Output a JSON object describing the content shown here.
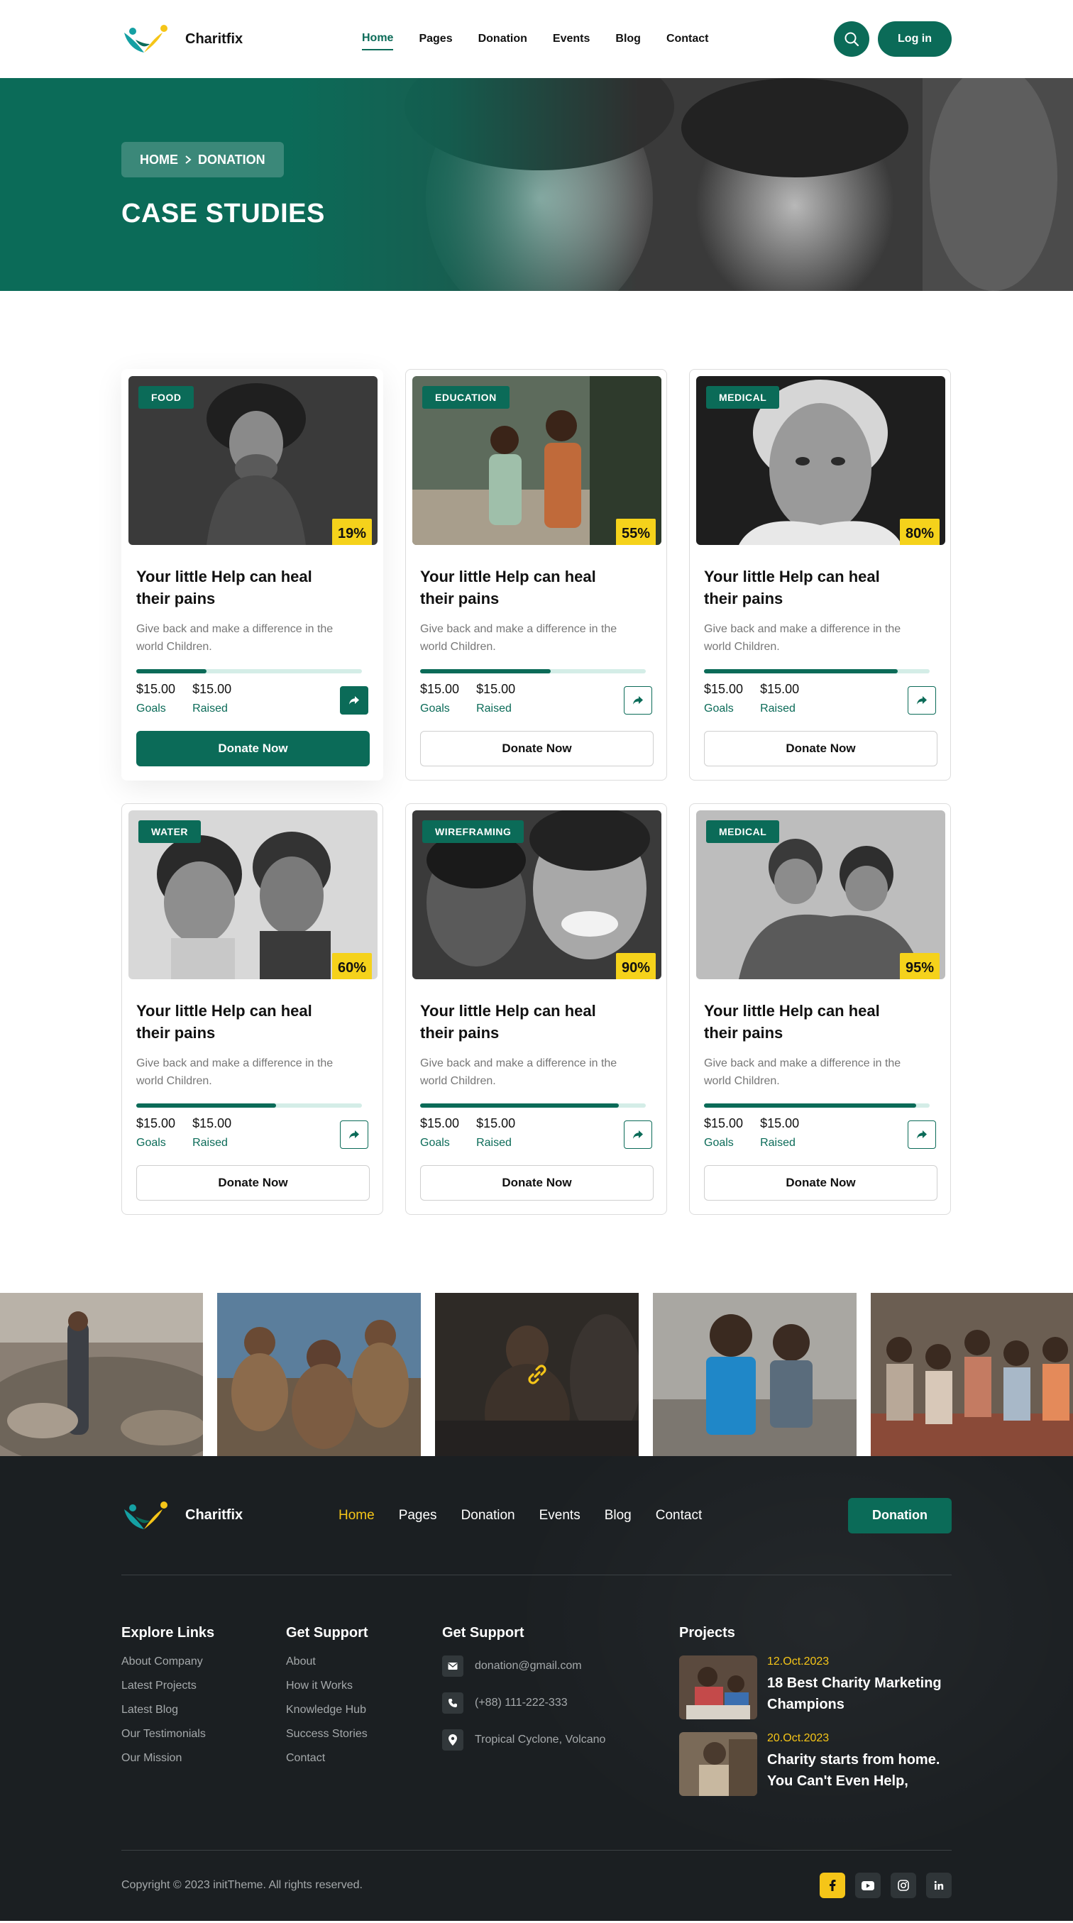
{
  "brand": {
    "name": "Charitfix"
  },
  "nav": {
    "items": [
      {
        "label": "Home",
        "active": true
      },
      {
        "label": "Pages"
      },
      {
        "label": "Donation"
      },
      {
        "label": "Events"
      },
      {
        "label": "Blog"
      },
      {
        "label": "Contact"
      }
    ],
    "login_label": "Log in",
    "search_icon": "search-icon"
  },
  "hero": {
    "breadcrumb": [
      "HOME",
      "DONATION"
    ],
    "title": "CASE STUDIES"
  },
  "colors": {
    "primary": "#0b6b58",
    "accent": "#f5d21b",
    "footer_bg": "#1b1f22",
    "link_yellow": "#f5c518"
  },
  "cards": [
    {
      "tag": "FOOD",
      "percent": "19%",
      "progress": 0.31,
      "title": "Your little Help can heal their pains",
      "desc": "Give back and make a difference in the world Children.",
      "goal": "$15.00",
      "goal_label": "Goals",
      "raised": "$15.00",
      "raised_label": "Raised",
      "button": "Donate Now",
      "featured": true
    },
    {
      "tag": "EDUCATION",
      "percent": "55%",
      "progress": 0.58,
      "title": "Your little Help can heal their pains",
      "desc": "Give back and make a difference in the world Children.",
      "goal": "$15.00",
      "goal_label": "Goals",
      "raised": "$15.00",
      "raised_label": "Raised",
      "button": "Donate Now",
      "featured": false
    },
    {
      "tag": "MEDICAL",
      "percent": "80%",
      "progress": 0.86,
      "title": "Your little Help can heal their pains",
      "desc": "Give back and make a difference in the world Children.",
      "goal": "$15.00",
      "goal_label": "Goals",
      "raised": "$15.00",
      "raised_label": "Raised",
      "button": "Donate Now",
      "featured": false
    },
    {
      "tag": "WATER",
      "percent": "60%",
      "progress": 0.62,
      "title": "Your little Help can heal their pains",
      "desc": "Give back and make a difference in the world Children.",
      "goal": "$15.00",
      "goal_label": "Goals",
      "raised": "$15.00",
      "raised_label": "Raised",
      "button": "Donate Now",
      "featured": false
    },
    {
      "tag": "WIREFRAMING",
      "percent": "90%",
      "progress": 0.88,
      "title": "Your little Help can heal their pains",
      "desc": "Give back and make a difference in the world Children.",
      "goal": "$15.00",
      "goal_label": "Goals",
      "raised": "$15.00",
      "raised_label": "Raised",
      "button": "Donate Now",
      "featured": false
    },
    {
      "tag": "MEDICAL",
      "percent": "95%",
      "progress": 0.94,
      "title": "Your little Help can heal their pains",
      "desc": "Give back and make a difference in the world Children.",
      "goal": "$15.00",
      "goal_label": "Goals",
      "raised": "$15.00",
      "raised_label": "Raised",
      "button": "Donate Now",
      "featured": false
    }
  ],
  "footer": {
    "nav": [
      {
        "label": "Home",
        "active": true
      },
      {
        "label": "Pages"
      },
      {
        "label": "Donation"
      },
      {
        "label": "Events"
      },
      {
        "label": "Blog"
      },
      {
        "label": "Contact"
      }
    ],
    "donate_label": "Donation",
    "explore": {
      "heading": "Explore Links",
      "links": [
        "About Company",
        "Latest Projects",
        "Latest Blog",
        "Our Testimonials",
        "Our Mission"
      ]
    },
    "support": {
      "heading": "Get Support",
      "links": [
        "About",
        "How it Works",
        "Knowledge Hub",
        "Success Stories",
        "Contact"
      ]
    },
    "contact": {
      "heading": "Get Support",
      "email": "donation@gmail.com",
      "phone": "(+88) 111-222-333",
      "address": "Tropical Cyclone, Volcano"
    },
    "projects": {
      "heading": "Projects",
      "items": [
        {
          "date": "12.Oct.2023",
          "title": "18 Best Charity Marketing Champions"
        },
        {
          "date": "20.Oct.2023",
          "title": "Charity starts from home. You Can't Even Help,"
        }
      ]
    },
    "copyright": "Copyright © 2023 initTheme. All rights reserved.",
    "socials": [
      "facebook-icon",
      "youtube-icon",
      "instagram-icon",
      "linkedin-icon"
    ]
  }
}
